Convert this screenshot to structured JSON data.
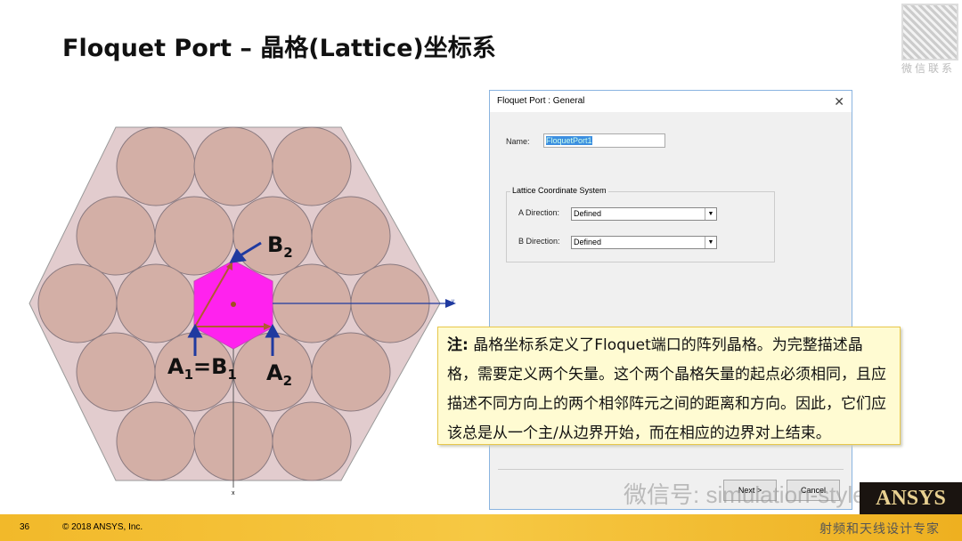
{
  "slide": {
    "title": "Floquet Port – 晶格(Lattice)坐标系",
    "page_number": "36",
    "copyright": "© 2018 ANSYS, Inc."
  },
  "qr": {
    "label": "微信联系"
  },
  "diagram": {
    "labels": {
      "b2": "B",
      "b2_sub": "2",
      "a1": "A",
      "a1_sub": "1",
      "eq": "=B",
      "b1_sub": "1",
      "a2": "A",
      "a2_sub": "2",
      "axis_y": "y",
      "axis_x": "x"
    },
    "colors": {
      "cell": "#ff22ee",
      "background": "#e2ccce",
      "circle": "#d3afa6",
      "arrow": "#1f3aa0",
      "vector": "#b05a30"
    }
  },
  "dialog": {
    "title": "Floquet Port : General",
    "close": "✕",
    "name_label": "Name:",
    "name_value": "FloquetPort1",
    "group_label": "Lattice Coordinate System",
    "a_label": "A  Direction:",
    "a_value": "Defined",
    "b_label": "B  Direction:",
    "b_value": "Defined",
    "next": "Next >",
    "cancel": "Cancel"
  },
  "note": {
    "prefix": "注:",
    "text": " 晶格坐标系定义了Floquet端口的阵列晶格。为完整描述晶格，需要定义两个矢量。这个两个晶格矢量的起点必须相同，且应描述不同方向上的两个相邻阵元之间的距离和方向。因此，它们应该总是从一个主/从边界开始，而在相应的边界对上结束。"
  },
  "watermark": {
    "text": "微信号: simulation-style",
    "brand": "ANSYS",
    "tagline": "射频和天线设计专家"
  }
}
